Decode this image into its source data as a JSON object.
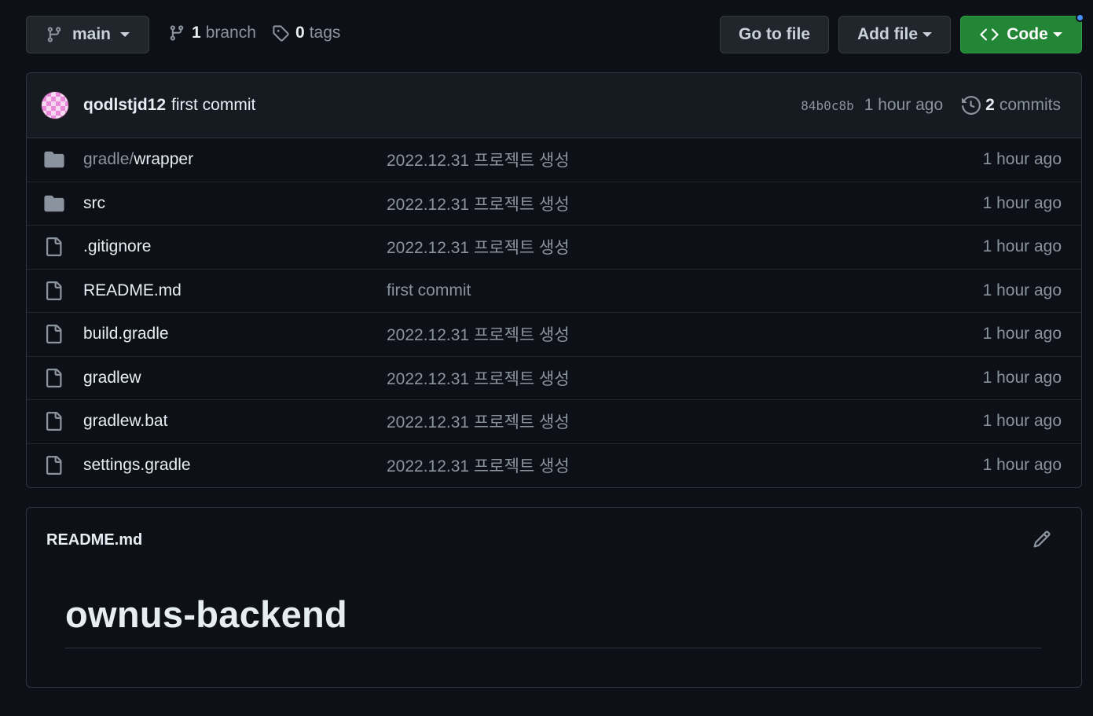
{
  "toolbar": {
    "branch_button": {
      "label": "main"
    },
    "branches": {
      "count": "1",
      "label": "branch"
    },
    "tags": {
      "count": "0",
      "label": "tags"
    },
    "goto_file_label": "Go to file",
    "add_file_label": "Add file",
    "code_label": "Code"
  },
  "latest_commit": {
    "author": "qodlstjd12",
    "message": "first commit",
    "sha": "84b0c8b",
    "time": "1 hour ago",
    "commit_count": "2",
    "commit_label": "commits"
  },
  "files": [
    {
      "type": "dir",
      "prefix": "gradle/",
      "name": "wrapper",
      "message": "2022.12.31 프로젝트 생성",
      "time": "1 hour ago"
    },
    {
      "type": "dir",
      "prefix": "",
      "name": "src",
      "message": "2022.12.31 프로젝트 생성",
      "time": "1 hour ago"
    },
    {
      "type": "file",
      "prefix": "",
      "name": ".gitignore",
      "message": "2022.12.31 프로젝트 생성",
      "time": "1 hour ago"
    },
    {
      "type": "file",
      "prefix": "",
      "name": "README.md",
      "message": "first commit",
      "time": "1 hour ago"
    },
    {
      "type": "file",
      "prefix": "",
      "name": "build.gradle",
      "message": "2022.12.31 프로젝트 생성",
      "time": "1 hour ago"
    },
    {
      "type": "file",
      "prefix": "",
      "name": "gradlew",
      "message": "2022.12.31 프로젝트 생성",
      "time": "1 hour ago"
    },
    {
      "type": "file",
      "prefix": "",
      "name": "gradlew.bat",
      "message": "2022.12.31 프로젝트 생성",
      "time": "1 hour ago"
    },
    {
      "type": "file",
      "prefix": "",
      "name": "settings.gradle",
      "message": "2022.12.31 프로젝트 생성",
      "time": "1 hour ago"
    }
  ],
  "readme": {
    "filename": "README.md",
    "heading": "ownus-backend"
  },
  "colors": {
    "background": "#0d1117",
    "code_button": "#238636",
    "notification_dot": "#4493f8",
    "muted_text": "#8b949e"
  }
}
